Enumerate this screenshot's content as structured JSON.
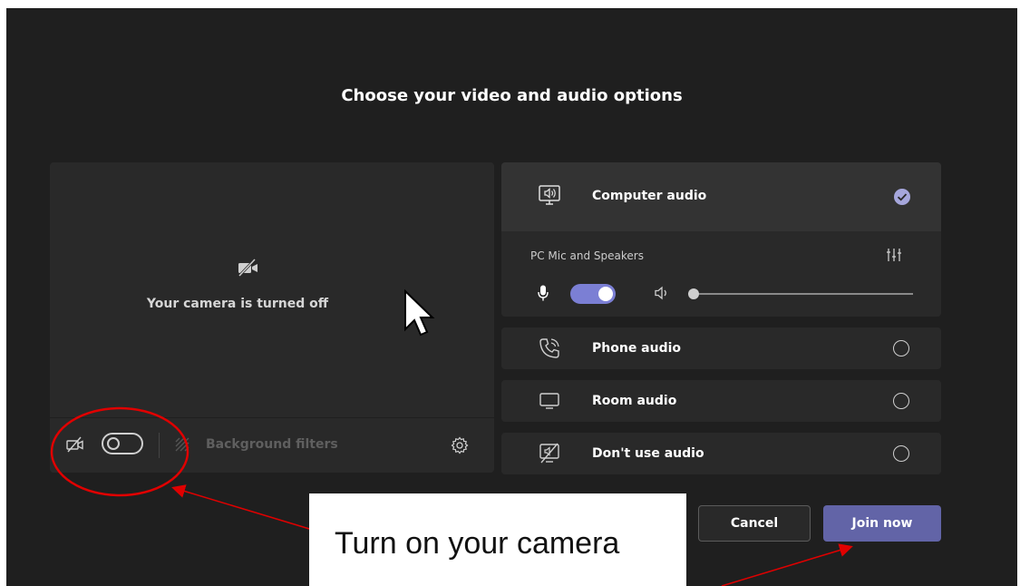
{
  "page": {
    "title": "Choose your video and audio options"
  },
  "video": {
    "camera_off_text": "Your camera is turned off",
    "camera_toggle_on": false,
    "background_filters_label": "Background filters"
  },
  "audio": {
    "computer_audio": {
      "label": "Computer audio",
      "selected": true,
      "device_label": "PC Mic and Speakers",
      "mic_on": true,
      "volume_fraction": 0.0
    },
    "options": [
      {
        "label": "Phone audio",
        "icon": "phone-icon",
        "selected": false
      },
      {
        "label": "Room audio",
        "icon": "monitor-icon",
        "selected": false
      },
      {
        "label": "Don't use audio",
        "icon": "no-audio-icon",
        "selected": false
      }
    ]
  },
  "actions": {
    "cancel_label": "Cancel",
    "join_label": "Join now"
  },
  "annotation": {
    "callout_text": "Turn on your camera",
    "color": "#e00000"
  },
  "colors": {
    "accent": "#6264a7",
    "toggle_on": "#7b7fd4",
    "background": "#1f1f1f",
    "panel": "#292929"
  }
}
